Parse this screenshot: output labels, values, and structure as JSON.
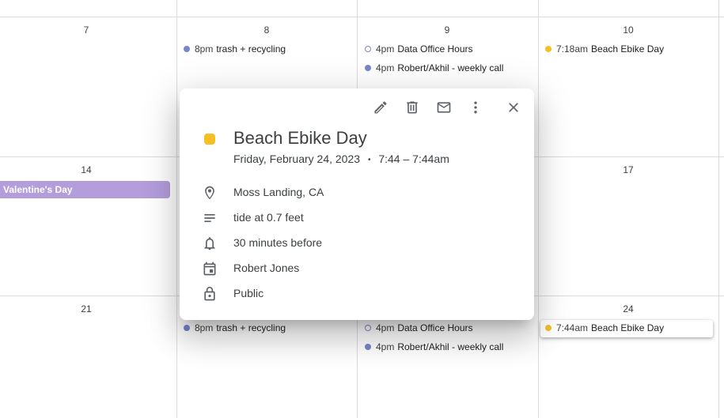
{
  "calendar": {
    "days": {
      "d7": "7",
      "d8": "8",
      "d9": "9",
      "d10": "10",
      "d14": "14",
      "d17": "17",
      "d21": "21",
      "d24": "24"
    },
    "events": {
      "w1_trash": {
        "time": "8pm",
        "title": "trash + recycling"
      },
      "w1_office": {
        "time": "4pm",
        "title": "Data Office Hours"
      },
      "w1_robert": {
        "time": "4pm",
        "title": "Robert/Akhil - weekly call"
      },
      "w1_beach": {
        "time": "7:18am",
        "title": "Beach Ebike Day"
      },
      "w2_valentine": {
        "title": "Valentine's Day"
      },
      "w3_trash": {
        "time": "8pm",
        "title": "trash + recycling"
      },
      "w3_office": {
        "time": "4pm",
        "title": "Data Office Hours"
      },
      "w3_robert": {
        "time": "4pm",
        "title": "Robert/Akhil - weekly call"
      },
      "w3_beach": {
        "time": "7:44am",
        "title": "Beach Ebike Day"
      }
    },
    "colors": {
      "blue": "#7986cb",
      "yellow": "#f6bf26",
      "purple": "#b39ddb"
    }
  },
  "popup": {
    "title": "Beach Ebike Day",
    "date": "Friday, February 24, 2023",
    "separator": "•",
    "time": "7:44 – 7:44am",
    "location": "Moss Landing, CA",
    "description": "tide at 0.7 feet",
    "reminder": "30 minutes before",
    "calendar_owner": "Robert Jones",
    "visibility": "Public",
    "icons": [
      "edit-icon",
      "delete-icon",
      "email-icon",
      "more-icon",
      "close-icon",
      "location-icon",
      "description-icon",
      "bell-icon",
      "calendar-icon",
      "lock-icon"
    ]
  }
}
